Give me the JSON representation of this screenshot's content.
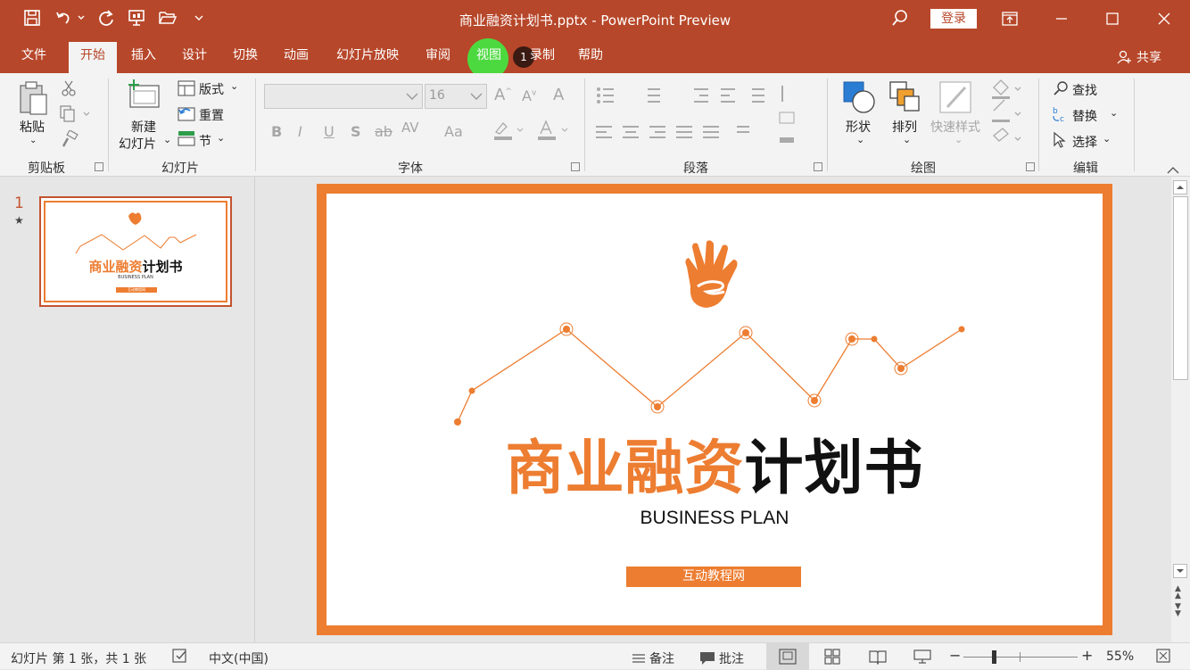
{
  "window": {
    "title": "商业融资计划书.pptx  -  PowerPoint Preview",
    "login_label": "登录"
  },
  "menu": {
    "tabs": [
      "文件",
      "开始",
      "插入",
      "设计",
      "切换",
      "动画",
      "幻灯片放映",
      "审阅",
      "视图",
      "录制",
      "帮助"
    ],
    "active": "开始",
    "badge": "1",
    "share_label": "共享"
  },
  "ribbon": {
    "clipboard": {
      "paste": "粘贴",
      "group": "剪贴板"
    },
    "slides": {
      "new_slide_line1": "新建",
      "new_slide_line2": "幻灯片",
      "layout": "版式",
      "reset": "重置",
      "section": "节",
      "group": "幻灯片"
    },
    "font": {
      "font_name": "",
      "font_size": "16",
      "group": "字体",
      "bold": "B",
      "italic": "I",
      "underline": "U",
      "shadow": "S",
      "strike": "ab",
      "spacing": "AV",
      "case": "Aa"
    },
    "paragraph": {
      "group": "段落"
    },
    "drawing": {
      "shapes": "形状",
      "arrange": "排列",
      "quick_styles": "快速样式",
      "group": "绘图"
    },
    "editing": {
      "find": "查找",
      "replace": "替换",
      "select": "选择",
      "group": "编辑"
    }
  },
  "thumbnail": {
    "number": "1",
    "star": "★",
    "title_orange": "商业融资",
    "title_black": "计划书",
    "subtitle": "BUSINESS PLAN",
    "button": "互动教程网"
  },
  "slide": {
    "title_orange": "商业融资",
    "title_black": "计划书",
    "subtitle": "BUSINESS PLAN",
    "button": "互动教程网"
  },
  "status": {
    "slide_info": "幻灯片 第 1 张，共 1 张",
    "language": "中文(中国)",
    "notes": "备注",
    "comments": "批注",
    "zoom": "55%",
    "zoom_level": 0.55
  },
  "colors": {
    "accent": "#b7472a",
    "orange": "#ed7d31",
    "highlight": "#4cd93f"
  }
}
